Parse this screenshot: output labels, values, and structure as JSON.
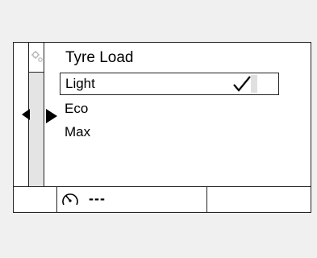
{
  "menu": {
    "title": "Tyre Load",
    "items": [
      {
        "label": "Light",
        "selected": true
      },
      {
        "label": "Eco",
        "selected": false
      },
      {
        "label": "Max",
        "selected": false
      }
    ]
  },
  "status": {
    "speed_value": "---"
  },
  "icons": {
    "settings": "settings-gear-icon",
    "left": "arrow-left-icon",
    "right": "arrow-right-icon",
    "check": "checkmark-icon",
    "gauge": "speedometer-icon"
  },
  "colors": {
    "text": "#000000",
    "border": "#222222",
    "panel": "#ffffff",
    "strip": "#e4e4e4"
  }
}
